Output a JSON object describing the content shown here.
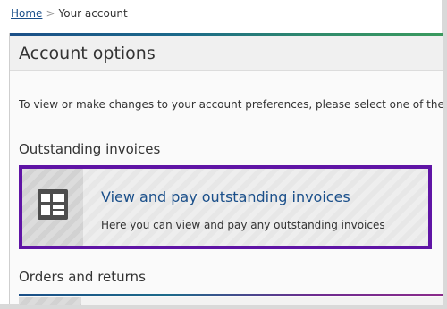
{
  "breadcrumb": {
    "home_label": "Home",
    "separator": ">",
    "current": "Your account"
  },
  "panel": {
    "title": "Account options",
    "intro": "To view or make changes to your account preferences, please select one of the ca"
  },
  "sections": [
    {
      "heading": "Outstanding invoices",
      "card": {
        "title": "View and pay outstanding invoices",
        "description": "Here you can view and pay any outstanding invoices",
        "icon": "invoice-grid-icon"
      }
    },
    {
      "heading": "Orders and returns"
    }
  ],
  "colors": {
    "link": "#1a4f8a",
    "focus_border": "#5f14a5",
    "icon_bg": "#4d4d4d"
  }
}
